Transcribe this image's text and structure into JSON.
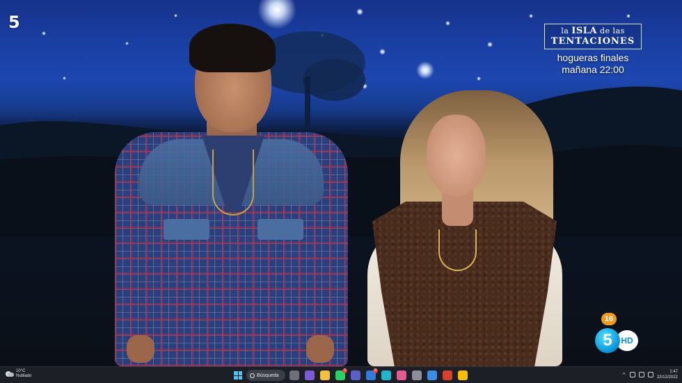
{
  "channel": {
    "logo_text": "5",
    "hd_logo_digit": "5",
    "hd_logo_label": "HD",
    "age_rating": "16",
    "age_rating_color": "#f19a1b"
  },
  "promo": {
    "line1_prefix": "la",
    "line1_bold": "ISLA",
    "line1_suffix": "de las",
    "line2": "TENTACIONES",
    "sub1": "hogueras finales",
    "sub2": "mañana 22:00"
  },
  "taskbar": {
    "weather_temp": "10°C",
    "weather_desc": "Nublado",
    "search_label": "Búsqueda",
    "apps": [
      {
        "name": "task-view",
        "color": "#6b7079",
        "badge": ""
      },
      {
        "name": "meet",
        "color": "#7b5cd6",
        "badge": ""
      },
      {
        "name": "files",
        "color": "#f3c13a",
        "badge": ""
      },
      {
        "name": "whatsapp",
        "color": "#25d366",
        "badge": "2"
      },
      {
        "name": "teams",
        "color": "#5b5fc7",
        "badge": ""
      },
      {
        "name": "mail",
        "color": "#2f7de1",
        "badge": "9"
      },
      {
        "name": "edge",
        "color": "#1fb6c9",
        "badge": ""
      },
      {
        "name": "photos",
        "color": "#e35b8f",
        "badge": ""
      },
      {
        "name": "settings",
        "color": "#8a8f99",
        "badge": ""
      },
      {
        "name": "store",
        "color": "#3c8de8",
        "badge": ""
      },
      {
        "name": "office",
        "color": "#d9412a",
        "badge": ""
      },
      {
        "name": "chrome",
        "color": "#fbbc04",
        "badge": ""
      }
    ],
    "clock_time": "1:47",
    "clock_date": "22/12/2022"
  }
}
